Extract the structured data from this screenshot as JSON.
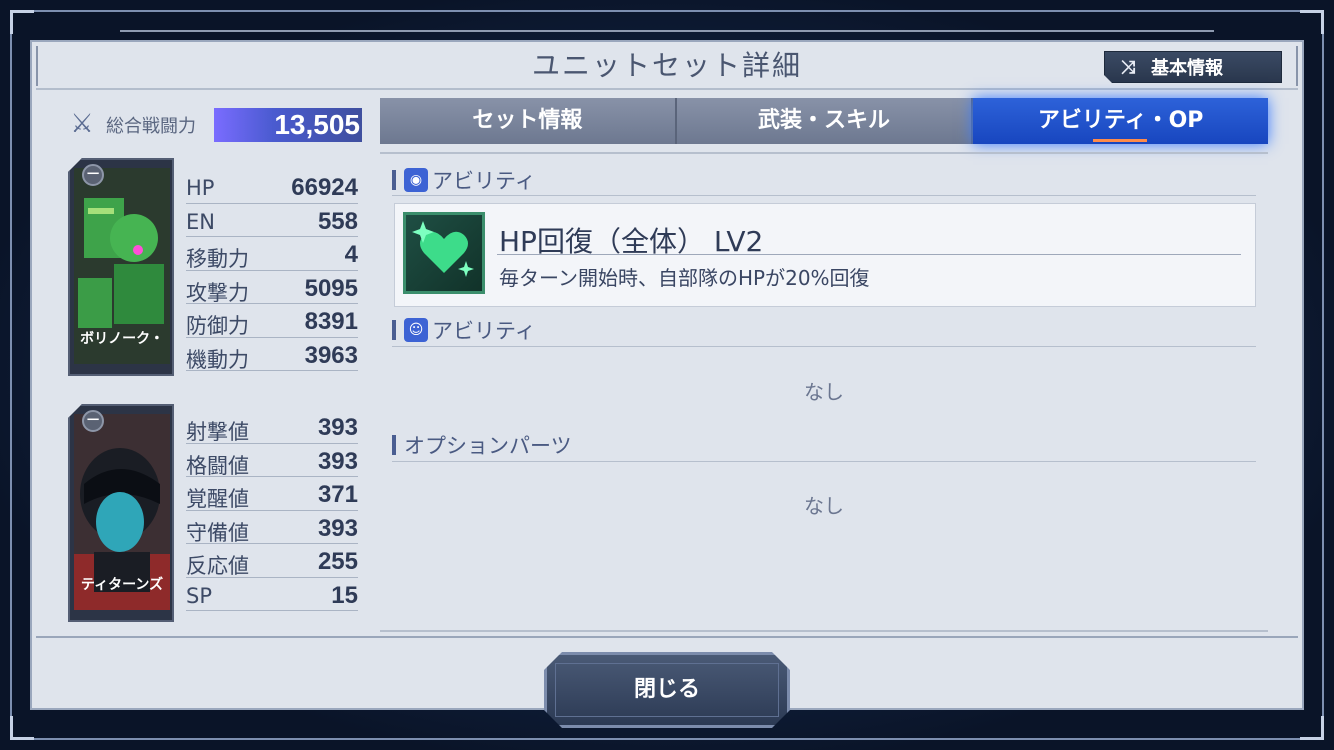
{
  "title": "ユニットセット詳細",
  "basic_info_button": {
    "label": "基本情報",
    "icon": "shuffle-icon"
  },
  "power": {
    "label": "総合戦闘力",
    "value": "13,505",
    "icon": "crossed-swords-icon"
  },
  "unit": {
    "name": "ボリノーク・",
    "stats": [
      {
        "name": "HP",
        "value": "66924"
      },
      {
        "name": "EN",
        "value": "558"
      },
      {
        "name": "移動力",
        "value": "4"
      },
      {
        "name": "攻撃力",
        "value": "5095"
      },
      {
        "name": "防御力",
        "value": "8391"
      },
      {
        "name": "機動力",
        "value": "3963"
      }
    ]
  },
  "pilot": {
    "name": "ティターンズ",
    "stats": [
      {
        "name": "射撃値",
        "value": "393"
      },
      {
        "name": "格闘値",
        "value": "393"
      },
      {
        "name": "覚醒値",
        "value": "371"
      },
      {
        "name": "守備値",
        "value": "393"
      },
      {
        "name": "反応値",
        "value": "255"
      },
      {
        "name": "SP",
        "value": "15"
      }
    ]
  },
  "tabs": [
    {
      "label": "セット情報",
      "active": false
    },
    {
      "label": "武装・スキル",
      "active": false
    },
    {
      "label": "アビリティ・OP",
      "active": true
    }
  ],
  "sections": {
    "unit_ability": {
      "label": "アビリティ",
      "items": [
        {
          "title": "HP回復（全体） LV2",
          "desc": "毎ターン開始時、自部隊のHPが20%回復",
          "icon": "heart-sparkle-icon"
        }
      ]
    },
    "pilot_ability": {
      "label": "アビリティ",
      "empty": "なし"
    },
    "option_parts": {
      "label": "オプションパーツ",
      "empty": "なし"
    }
  },
  "close_button": {
    "label": "閉じる"
  },
  "colors": {
    "accent_blue": "#1f52c9",
    "panel_bg": "#dfe4ec",
    "tab_gray": "#7a849a",
    "heart_green": "#3ddc8a"
  }
}
